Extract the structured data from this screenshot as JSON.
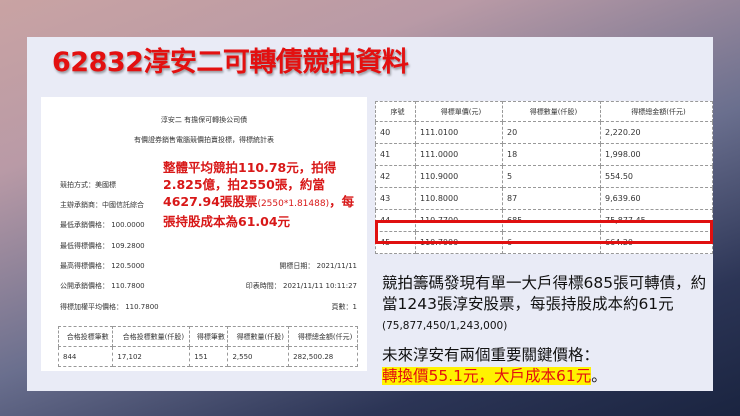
{
  "title": "62832淳安二可轉債競拍資料",
  "doc": {
    "heading": "淳安二 有擔保可轉換公司債",
    "subheading": "有價證券銷售電腦競價拍賣投標，得標統計表",
    "labels": [
      "競拍方式：美國標",
      "主辦承銷商：中國信託綜合",
      "最低承銷價格： 100.0000",
      "最低得標價格： 109.2800",
      "最高得標價格： 120.5000",
      "公開承銷價格： 110.7800",
      "得標加權平均價格： 110.7800"
    ],
    "right": [
      "開標日期： 2021/11/11",
      "印表時間： 2021/11/11 10:11:27",
      "頁數：1"
    ],
    "annotation": "整體平均競拍110.78元，拍得2.825億，拍2550張，約當4627.94張股票",
    "annotation_formula": "(2550*1.81488)",
    "annotation_end": "，每張持股成本為61.04元",
    "table": {
      "headers": [
        "合格投標筆數",
        "合格投標數量(仟股)",
        "得標筆數",
        "得標數量(仟股)",
        "得標總金額(仟元)"
      ],
      "row": [
        "844",
        "17,102",
        "151",
        "2,550",
        "282,500.28"
      ]
    }
  },
  "bids": {
    "headers": [
      "序號",
      "得標單價(元)",
      "得標數量(仟股)",
      "得標總金額(仟元)"
    ],
    "rows": [
      [
        "40",
        "111.0100",
        "20",
        "2,220.20"
      ],
      [
        "41",
        "111.0000",
        "18",
        "1,998.00"
      ],
      [
        "42",
        "110.9000",
        "5",
        "554.50"
      ],
      [
        "43",
        "110.8000",
        "87",
        "9,639.60"
      ],
      [
        "44",
        "110.7700",
        "685",
        "75,877.45"
      ],
      [
        "45",
        "110.7000",
        "6",
        "664.20"
      ]
    ]
  },
  "note1": "競拍籌碼發現有單一大戶得標685張可轉債，約當1243張淳安股票，每張持股成本約61元",
  "note1_calc": "(75,877,450/1,243,000)",
  "note2": "未來淳安有兩個重要關鍵價格：",
  "note2_highlight": "轉換價55.1元，大戶成本61元",
  "note2_end": "。"
}
